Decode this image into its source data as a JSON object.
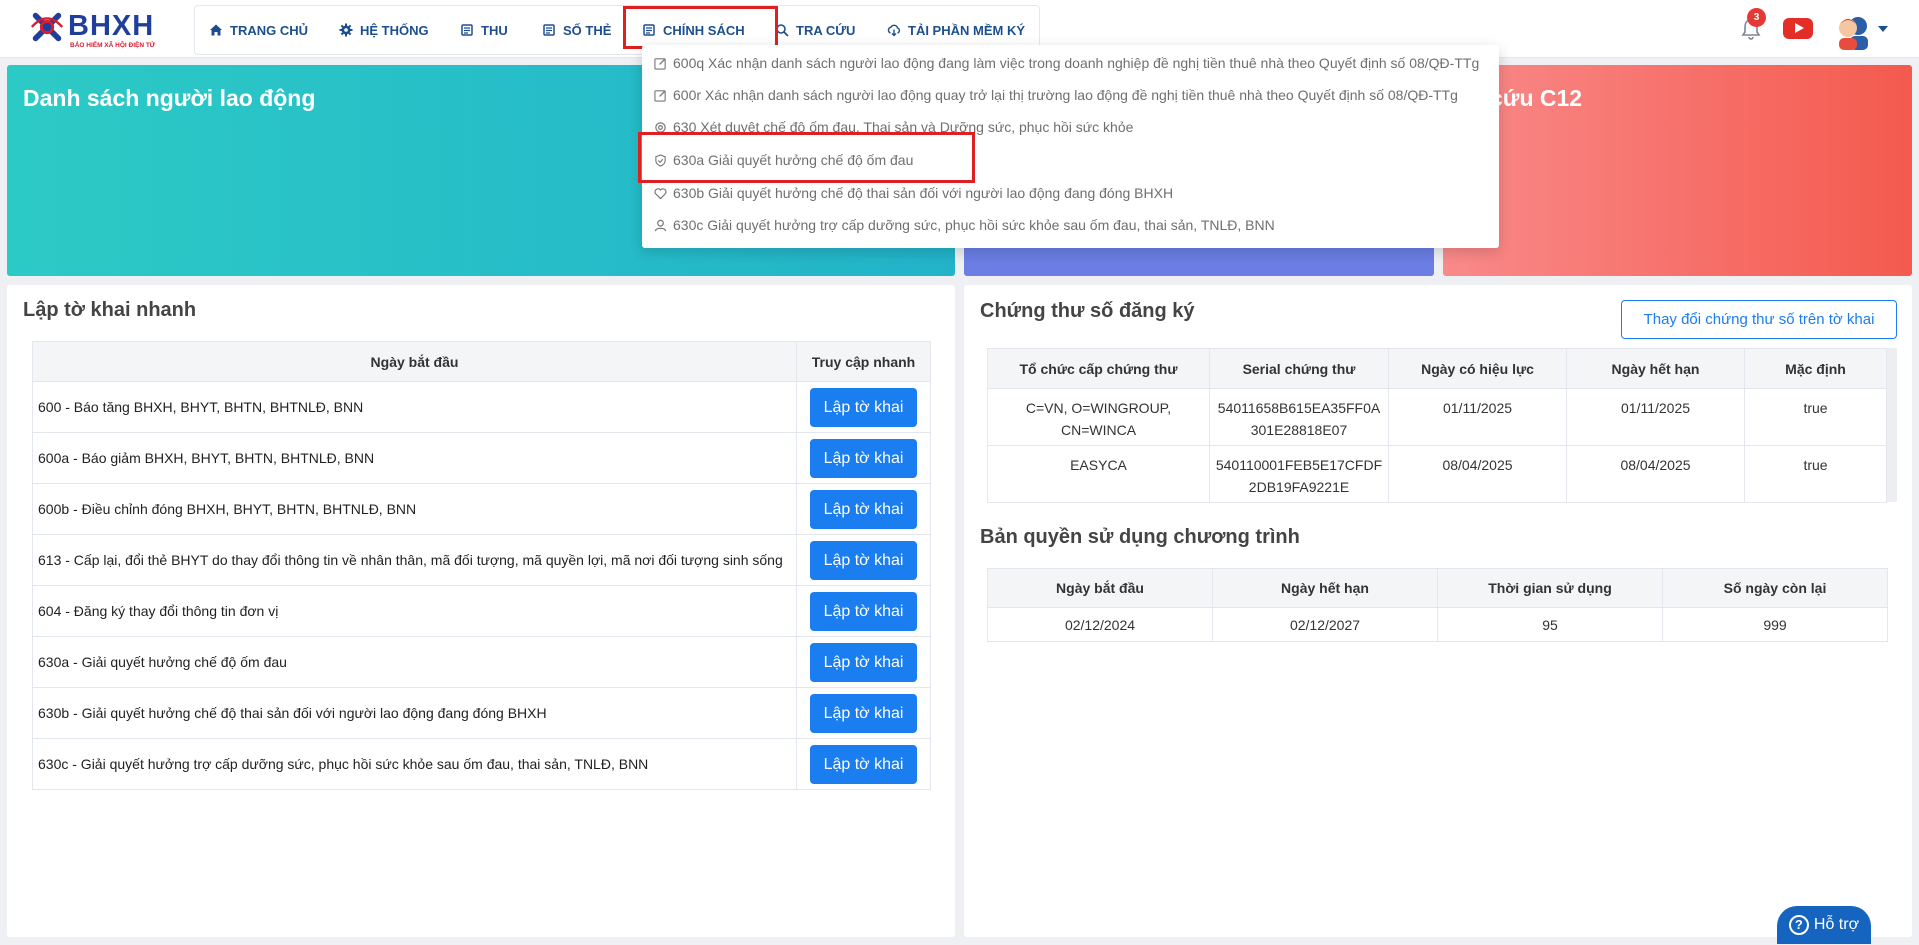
{
  "logo": {
    "brand": "BHXH",
    "subtitle": "BẢO HIỂM XÃ HỘI ĐIỆN TỬ"
  },
  "nav": [
    {
      "label": "TRANG CHỦ",
      "icon": "home-icon"
    },
    {
      "label": "HỆ THỐNG",
      "icon": "gear-icon"
    },
    {
      "label": "THU",
      "icon": "document-icon"
    },
    {
      "label": "SỐ THẺ",
      "icon": "document-icon"
    },
    {
      "label": "CHÍNH SÁCH",
      "icon": "document-icon"
    },
    {
      "label": "TRA CỨU",
      "icon": "search-icon"
    },
    {
      "label": "TẢI PHẦN MỀM KÝ",
      "icon": "cloud-download-icon"
    }
  ],
  "header": {
    "notification_count": "3"
  },
  "banners": {
    "left_title": "Danh sách người lao động",
    "right_title": "cứu C12"
  },
  "dropdown": {
    "items": [
      {
        "label": "600q Xác nhận danh sách người lao động đang làm việc trong doanh nghiệp đề nghị tiền thuê nhà theo Quyết định số 08/QĐ-TTg",
        "icon": "edit-icon"
      },
      {
        "label": "600r Xác nhận danh sách người lao động quay trở lại thị trường lao động đề nghị tiền thuê nhà theo Quyết định số 08/QĐ-TTg",
        "icon": "edit-icon"
      },
      {
        "label": "630 Xét duyệt chế độ ốm đau, Thai sản và Dưỡng sức, phục hồi sức khỏe",
        "icon": "settings-icon"
      },
      {
        "label": "630a Giải quyết hưởng chế độ ốm đau",
        "icon": "shield-check-icon"
      },
      {
        "label": "630b Giải quyết hưởng chế độ thai sản đối với người lao động đang đóng BHXH",
        "icon": "heart-icon"
      },
      {
        "label": "630c Giải quyết hưởng trợ cấp dưỡng sức, phục hồi sức khỏe sau ốm đau, thai sản, TNLĐ, BNN",
        "icon": "user-icon"
      }
    ]
  },
  "quick": {
    "title": "Lập tờ khai nhanh",
    "col_name": "Ngày bắt đầu",
    "col_action": "Truy cập nhanh",
    "button_label": "Lập tờ khai",
    "rows": [
      "600 - Báo tăng BHXH, BHYT, BHTN, BHTNLĐ, BNN",
      "600a - Báo giảm BHXH, BHYT, BHTN, BHTNLĐ, BNN",
      "600b - Điều chỉnh đóng BHXH, BHYT, BHTN, BHTNLĐ, BNN",
      "613 - Cấp lại, đổi thẻ BHYT do thay đổi thông tin về nhân thân, mã đối tượng, mã quyền lợi, mã nơi đối tượng sinh sống",
      "604 - Đăng ký thay đổi thông tin đơn vị",
      "630a - Giải quyết hưởng chế độ ốm đau",
      "630b - Giải quyết hưởng chế độ thai sản đối với người lao động đang đóng BHXH",
      "630c - Giải quyết hưởng trợ cấp dưỡng sức, phục hồi sức khỏe sau ốm đau, thai sản, TNLĐ, BNN"
    ]
  },
  "cert": {
    "title": "Chứng thư số đăng ký",
    "change_button": "Thay đổi chứng thư số trên tờ khai",
    "columns": [
      "Tổ chức cấp chứng thư",
      "Serial chứng thư",
      "Ngày có hiệu lực",
      "Ngày hết hạn",
      "Mặc định"
    ],
    "rows": [
      {
        "issuer": "C=VN, O=WINGROUP, CN=WINCA",
        "serial_1": "54011658B615EA35FF0A",
        "serial_2": "301E28818E07",
        "valid_from": "01/11/2025",
        "valid_to": "01/11/2025",
        "default": "true"
      },
      {
        "issuer": "EASYCA",
        "serial_1": "540110001FEB5E17CFDF",
        "serial_2": "2DB19FA9221E",
        "valid_from": "08/04/2025",
        "valid_to": "08/04/2025",
        "default": "true"
      }
    ]
  },
  "license": {
    "title": "Bản quyền sử dụng chương trình",
    "columns": [
      "Ngày bắt đầu",
      "Ngày hết hạn",
      "Thời gian sử dụng",
      "Số ngày còn lại"
    ],
    "row": {
      "start": "02/12/2024",
      "end": "02/12/2027",
      "used": "95",
      "remaining": "999"
    }
  },
  "help": {
    "label": "Hỗ trợ"
  },
  "colors": {
    "primary": "#1a7df0",
    "nav_text": "#1d4f8f",
    "highlight": "#e02020"
  }
}
